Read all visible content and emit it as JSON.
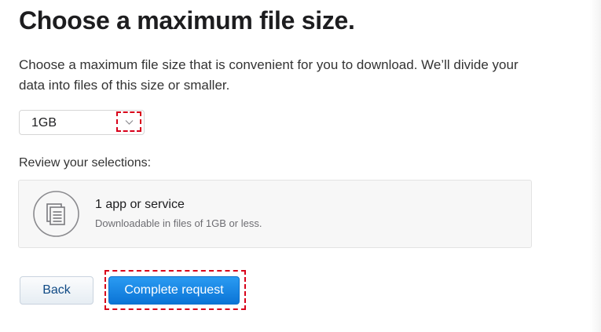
{
  "header": {
    "title": "Choose a maximum file size."
  },
  "intro": {
    "text": "Choose a maximum file size that is convenient for you to download. We’ll divide your data into files of this size or smaller."
  },
  "size_select": {
    "selected": "1GB",
    "icon": "chevron-down-icon"
  },
  "review": {
    "label": "Review your selections:",
    "item": {
      "icon": "document-stack-icon",
      "title": "1 app or service",
      "subtitle": "Downloadable in files of 1GB or less."
    }
  },
  "actions": {
    "back_label": "Back",
    "complete_label": "Complete request"
  },
  "colors": {
    "primary_button": "#1a84e3",
    "link_text": "#0f4a85",
    "highlight_dash": "#d8001a"
  }
}
